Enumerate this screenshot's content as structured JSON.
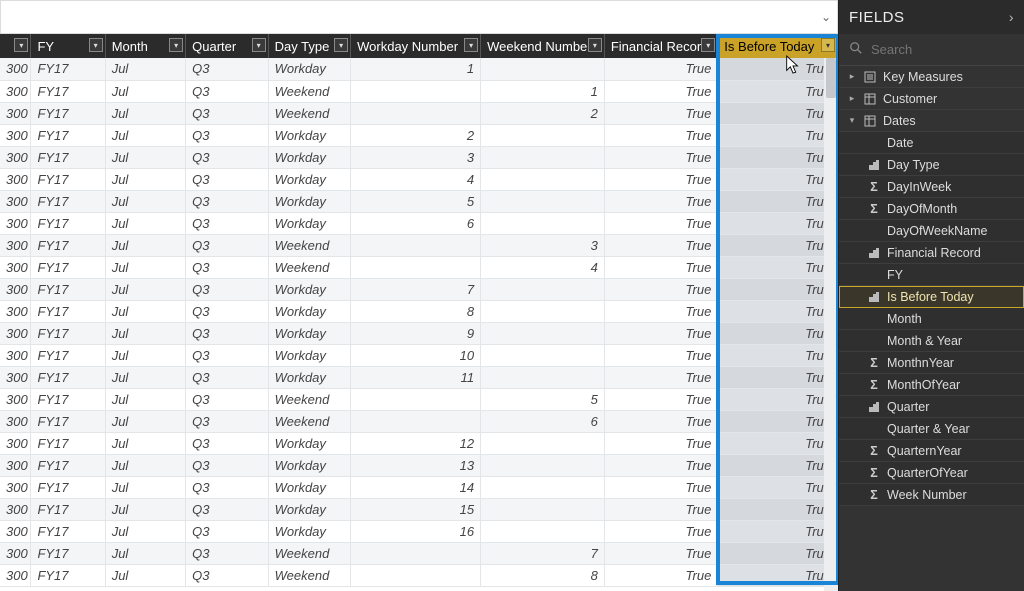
{
  "fields_pane": {
    "title": "FIELDS",
    "search_placeholder": "Search",
    "tables": [
      {
        "name": "Key Measures",
        "expanded": false,
        "icon": "calc"
      },
      {
        "name": "Customer",
        "expanded": false,
        "icon": "table"
      },
      {
        "name": "Dates",
        "expanded": true,
        "icon": "table",
        "fields": [
          {
            "name": "Date",
            "icon": ""
          },
          {
            "name": "Day Type",
            "icon": "hier"
          },
          {
            "name": "DayInWeek",
            "icon": "sigma"
          },
          {
            "name": "DayOfMonth",
            "icon": "sigma"
          },
          {
            "name": "DayOfWeekName",
            "icon": ""
          },
          {
            "name": "Financial Record",
            "icon": "hier"
          },
          {
            "name": "FY",
            "icon": ""
          },
          {
            "name": "Is Before Today",
            "icon": "hier",
            "selected": true
          },
          {
            "name": "Month",
            "icon": ""
          },
          {
            "name": "Month & Year",
            "icon": ""
          },
          {
            "name": "MonthnYear",
            "icon": "sigma"
          },
          {
            "name": "MonthOfYear",
            "icon": "sigma"
          },
          {
            "name": "Quarter",
            "icon": "hier"
          },
          {
            "name": "Quarter & Year",
            "icon": ""
          },
          {
            "name": "QuarternYear",
            "icon": "sigma"
          },
          {
            "name": "QuarterOfYear",
            "icon": "sigma"
          },
          {
            "name": "Week Number",
            "icon": "sigma"
          }
        ]
      }
    ]
  },
  "grid": {
    "columns": [
      {
        "key": "id",
        "label": "",
        "align": "right"
      },
      {
        "key": "fy",
        "label": "FY"
      },
      {
        "key": "month",
        "label": "Month"
      },
      {
        "key": "quarter",
        "label": "Quarter"
      },
      {
        "key": "daytype",
        "label": "Day Type"
      },
      {
        "key": "workday_num",
        "label": "Workday Number",
        "align": "right"
      },
      {
        "key": "weekend_num",
        "label": "Weekend Number",
        "align": "right"
      },
      {
        "key": "fin_record",
        "label": "Financial Record",
        "align": "right"
      },
      {
        "key": "is_before",
        "label": "Is Before Today",
        "align": "right",
        "highlight": true
      }
    ],
    "rows": [
      {
        "id": "300",
        "fy": "FY17",
        "month": "Jul",
        "quarter": "Q3",
        "daytype": "Workday",
        "workday_num": "1",
        "weekend_num": "",
        "fin_record": "True",
        "is_before": "True"
      },
      {
        "id": "300",
        "fy": "FY17",
        "month": "Jul",
        "quarter": "Q3",
        "daytype": "Weekend",
        "workday_num": "",
        "weekend_num": "1",
        "fin_record": "True",
        "is_before": "True"
      },
      {
        "id": "300",
        "fy": "FY17",
        "month": "Jul",
        "quarter": "Q3",
        "daytype": "Weekend",
        "workday_num": "",
        "weekend_num": "2",
        "fin_record": "True",
        "is_before": "True"
      },
      {
        "id": "300",
        "fy": "FY17",
        "month": "Jul",
        "quarter": "Q3",
        "daytype": "Workday",
        "workday_num": "2",
        "weekend_num": "",
        "fin_record": "True",
        "is_before": "True"
      },
      {
        "id": "300",
        "fy": "FY17",
        "month": "Jul",
        "quarter": "Q3",
        "daytype": "Workday",
        "workday_num": "3",
        "weekend_num": "",
        "fin_record": "True",
        "is_before": "True"
      },
      {
        "id": "300",
        "fy": "FY17",
        "month": "Jul",
        "quarter": "Q3",
        "daytype": "Workday",
        "workday_num": "4",
        "weekend_num": "",
        "fin_record": "True",
        "is_before": "True"
      },
      {
        "id": "300",
        "fy": "FY17",
        "month": "Jul",
        "quarter": "Q3",
        "daytype": "Workday",
        "workday_num": "5",
        "weekend_num": "",
        "fin_record": "True",
        "is_before": "True"
      },
      {
        "id": "300",
        "fy": "FY17",
        "month": "Jul",
        "quarter": "Q3",
        "daytype": "Workday",
        "workday_num": "6",
        "weekend_num": "",
        "fin_record": "True",
        "is_before": "True"
      },
      {
        "id": "300",
        "fy": "FY17",
        "month": "Jul",
        "quarter": "Q3",
        "daytype": "Weekend",
        "workday_num": "",
        "weekend_num": "3",
        "fin_record": "True",
        "is_before": "True"
      },
      {
        "id": "300",
        "fy": "FY17",
        "month": "Jul",
        "quarter": "Q3",
        "daytype": "Weekend",
        "workday_num": "",
        "weekend_num": "4",
        "fin_record": "True",
        "is_before": "True"
      },
      {
        "id": "300",
        "fy": "FY17",
        "month": "Jul",
        "quarter": "Q3",
        "daytype": "Workday",
        "workday_num": "7",
        "weekend_num": "",
        "fin_record": "True",
        "is_before": "True"
      },
      {
        "id": "300",
        "fy": "FY17",
        "month": "Jul",
        "quarter": "Q3",
        "daytype": "Workday",
        "workday_num": "8",
        "weekend_num": "",
        "fin_record": "True",
        "is_before": "True"
      },
      {
        "id": "300",
        "fy": "FY17",
        "month": "Jul",
        "quarter": "Q3",
        "daytype": "Workday",
        "workday_num": "9",
        "weekend_num": "",
        "fin_record": "True",
        "is_before": "True"
      },
      {
        "id": "300",
        "fy": "FY17",
        "month": "Jul",
        "quarter": "Q3",
        "daytype": "Workday",
        "workday_num": "10",
        "weekend_num": "",
        "fin_record": "True",
        "is_before": "True"
      },
      {
        "id": "300",
        "fy": "FY17",
        "month": "Jul",
        "quarter": "Q3",
        "daytype": "Workday",
        "workday_num": "11",
        "weekend_num": "",
        "fin_record": "True",
        "is_before": "True"
      },
      {
        "id": "300",
        "fy": "FY17",
        "month": "Jul",
        "quarter": "Q3",
        "daytype": "Weekend",
        "workday_num": "",
        "weekend_num": "5",
        "fin_record": "True",
        "is_before": "True"
      },
      {
        "id": "300",
        "fy": "FY17",
        "month": "Jul",
        "quarter": "Q3",
        "daytype": "Weekend",
        "workday_num": "",
        "weekend_num": "6",
        "fin_record": "True",
        "is_before": "True"
      },
      {
        "id": "300",
        "fy": "FY17",
        "month": "Jul",
        "quarter": "Q3",
        "daytype": "Workday",
        "workday_num": "12",
        "weekend_num": "",
        "fin_record": "True",
        "is_before": "True"
      },
      {
        "id": "300",
        "fy": "FY17",
        "month": "Jul",
        "quarter": "Q3",
        "daytype": "Workday",
        "workday_num": "13",
        "weekend_num": "",
        "fin_record": "True",
        "is_before": "True"
      },
      {
        "id": "300",
        "fy": "FY17",
        "month": "Jul",
        "quarter": "Q3",
        "daytype": "Workday",
        "workday_num": "14",
        "weekend_num": "",
        "fin_record": "True",
        "is_before": "True"
      },
      {
        "id": "300",
        "fy": "FY17",
        "month": "Jul",
        "quarter": "Q3",
        "daytype": "Workday",
        "workday_num": "15",
        "weekend_num": "",
        "fin_record": "True",
        "is_before": "True"
      },
      {
        "id": "300",
        "fy": "FY17",
        "month": "Jul",
        "quarter": "Q3",
        "daytype": "Workday",
        "workday_num": "16",
        "weekend_num": "",
        "fin_record": "True",
        "is_before": "True"
      },
      {
        "id": "300",
        "fy": "FY17",
        "month": "Jul",
        "quarter": "Q3",
        "daytype": "Weekend",
        "workday_num": "",
        "weekend_num": "7",
        "fin_record": "True",
        "is_before": "True"
      },
      {
        "id": "300",
        "fy": "FY17",
        "month": "Jul",
        "quarter": "Q3",
        "daytype": "Weekend",
        "workday_num": "",
        "weekend_num": "8",
        "fin_record": "True",
        "is_before": "True"
      }
    ]
  }
}
